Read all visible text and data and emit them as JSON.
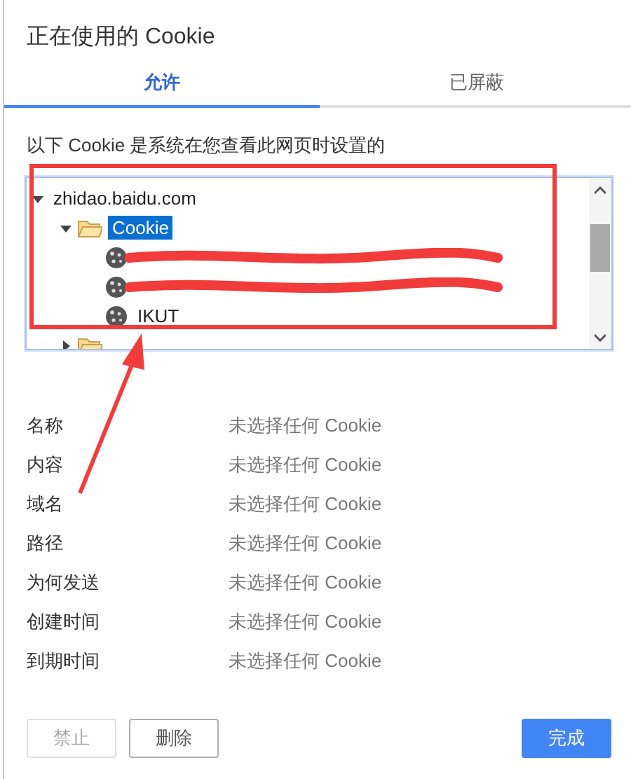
{
  "dialog": {
    "title": "正在使用的 Cookie"
  },
  "tabs": [
    {
      "label": "允许",
      "selected": true
    },
    {
      "label": "已屏蔽",
      "selected": false
    }
  ],
  "description": "以下 Cookie 是系统在您查看此网页时设置的",
  "tree": [
    {
      "kind": "site",
      "label": "zhidao.baidu.com",
      "expanded": true,
      "selected": false,
      "children": [
        {
          "kind": "folder",
          "label": "Cookie",
          "expanded": true,
          "selected": true,
          "children": [
            {
              "kind": "cookie",
              "redacted": true,
              "selected": false
            },
            {
              "kind": "cookie",
              "redacted": true,
              "selected": false
            },
            {
              "kind": "cookie",
              "label": "IKUT",
              "redacted": false,
              "selected": false
            }
          ]
        },
        {
          "kind": "folder",
          "expanded": false,
          "selected": false
        }
      ]
    }
  ],
  "details": [
    {
      "label": "名称",
      "value": "未选择任何 Cookie"
    },
    {
      "label": "内容",
      "value": "未选择任何 Cookie"
    },
    {
      "label": "域名",
      "value": "未选择任何 Cookie"
    },
    {
      "label": "路径",
      "value": "未选择任何 Cookie"
    },
    {
      "label": "为何发送",
      "value": "未选择任何 Cookie"
    },
    {
      "label": "创建时间",
      "value": "未选择任何 Cookie"
    },
    {
      "label": "到期时间",
      "value": "未选择任何 Cookie"
    }
  ],
  "buttons": [
    {
      "label": "禁止",
      "kind": "secondary",
      "disabled": true
    },
    {
      "label": "删除",
      "kind": "secondary",
      "disabled": false
    },
    {
      "label": "完成",
      "kind": "primary",
      "disabled": false
    }
  ]
}
